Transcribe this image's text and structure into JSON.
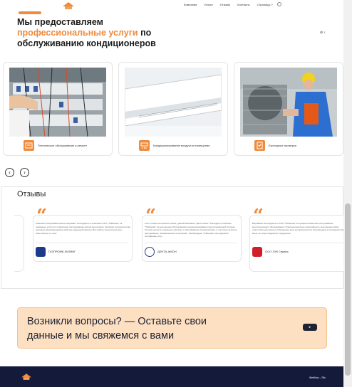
{
  "nav": {
    "items": [
      "Компания",
      "Услуги",
      "Отзывы",
      "Контакты",
      "Страницы"
    ]
  },
  "hero": {
    "title_line1": "Мы предоставляем",
    "title_accent": "профессиональные услуги",
    "title_line2_rest": " по",
    "title_line3": "обслуживанию кондиционеров"
  },
  "services": [
    {
      "label": "Техническое обслуживание и ремонт",
      "image": "electrical-panel",
      "icon": "wrench-icon"
    },
    {
      "label": "Кондиционирование воздуха в помещении",
      "image": "indoor-ac-unit",
      "icon": "ac-icon"
    },
    {
      "label": "Ежегодные проверки",
      "image": "outdoor-ac-technician",
      "icon": "checklist-icon"
    }
  ],
  "carousel": {
    "prev_icon": "arrow-left-icon",
    "next_icon": "arrow-right-icon"
  },
  "reviews": {
    "title": "Отзывы",
    "items": [
      {
        "text": "Компания Газпромбанк Лизинг выражает благодарность компании ООО \"ТеМоинка\" за оказанные услуги по сервисному обслуживанию систем вентиляции. За время сотрудничества компания зарекомендовала себя как надежный партнер. Все работы были выполнены качественно и в срок.",
        "name": "ГАЗПРОМБ.ЛИЗИНГ"
      },
      {
        "text": "Сеть стоматологических клиник, данной Компании \"Дента-Амон\" благодарит компанию \"ТеМоинка\" за выполнение обслуживания кондиционирования и вентиляционной системы. Оплата расчетов, оказанное качество и обслуживание специалистами, в том числе быстрое реагирование, своевременное исполнение. Рекомендуем \"ТеМоинка\" как надежного поставщика услуг.",
        "name": "ДЕНТА-АМОН"
      },
      {
        "text": "Выражаем благодарность ООО \"ТеМоинка\" за профессиональное обслуживание вентиляционного оборудования. Отмечаем высокую оперативность выполнения работ, ответственный подход и соблюдение всех договоренностей. Рекомендуем к сотрудничеству всем, кто ищет надежного подрядчика.",
        "name": "ООО ЛУК Сервис"
      }
    ]
  },
  "ask": {
    "text": "Возникли вопросы? — Оставьте свои данные и мы свяжемся с вами"
  },
  "footer": {
    "link": "Webflow – Sils"
  },
  "colors": {
    "accent": "#f08a3c",
    "footer_bg": "#131a3a",
    "banner_bg": "#fde0c2"
  }
}
